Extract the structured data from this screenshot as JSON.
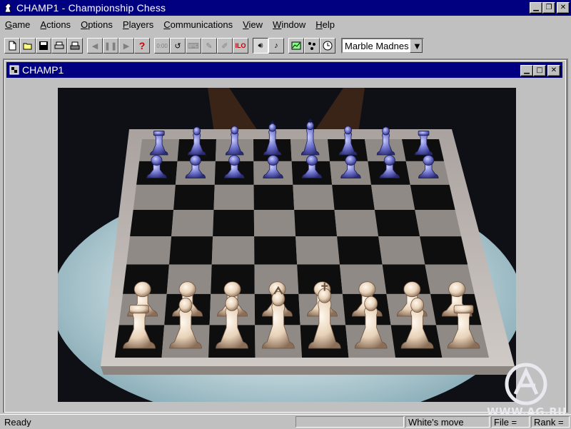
{
  "app": {
    "title": "CHAMP1 - Championship Chess"
  },
  "menu": [
    "Game",
    "Actions",
    "Options",
    "Players",
    "Communications",
    "View",
    "Window",
    "Help"
  ],
  "menu_underline": [
    "G",
    "A",
    "O",
    "P",
    "C",
    "V",
    "W",
    "H"
  ],
  "toolbar": {
    "counter_label": "0:00",
    "ilo_label": "ILO",
    "help_label": "?",
    "board_style": "Marble Madnes"
  },
  "child_window": {
    "title": "CHAMP1"
  },
  "board": {
    "ranks": [
      [
        "r",
        "n",
        "b",
        "q",
        "k",
        "b",
        "n",
        "r"
      ],
      [
        "p",
        "p",
        "p",
        "p",
        "p",
        "p",
        "p",
        "p"
      ],
      [
        "",
        "",
        "",
        "",
        "",
        "",
        "",
        ""
      ],
      [
        "",
        "",
        "",
        "",
        "",
        "",
        "",
        ""
      ],
      [
        "",
        "",
        "",
        "",
        "",
        "",
        "",
        ""
      ],
      [
        "",
        "",
        "",
        "",
        "",
        "",
        "",
        ""
      ],
      [
        "P",
        "P",
        "P",
        "P",
        "P",
        "P",
        "P",
        "P"
      ],
      [
        "R",
        "N",
        "B",
        "Q",
        "K",
        "B",
        "N",
        "R"
      ]
    ],
    "black_piece_color": "#6a6ec8",
    "white_piece_color": "#e8d2b8",
    "dark_square_color": "#0e0e0e",
    "light_square_color": "#8f8a86",
    "frame_color": "#b8b0ac"
  },
  "status": {
    "ready": "Ready",
    "turn": "White's move",
    "file": "File =",
    "rank": "Rank ="
  },
  "watermark": {
    "text": "WWW.AG.RU"
  }
}
